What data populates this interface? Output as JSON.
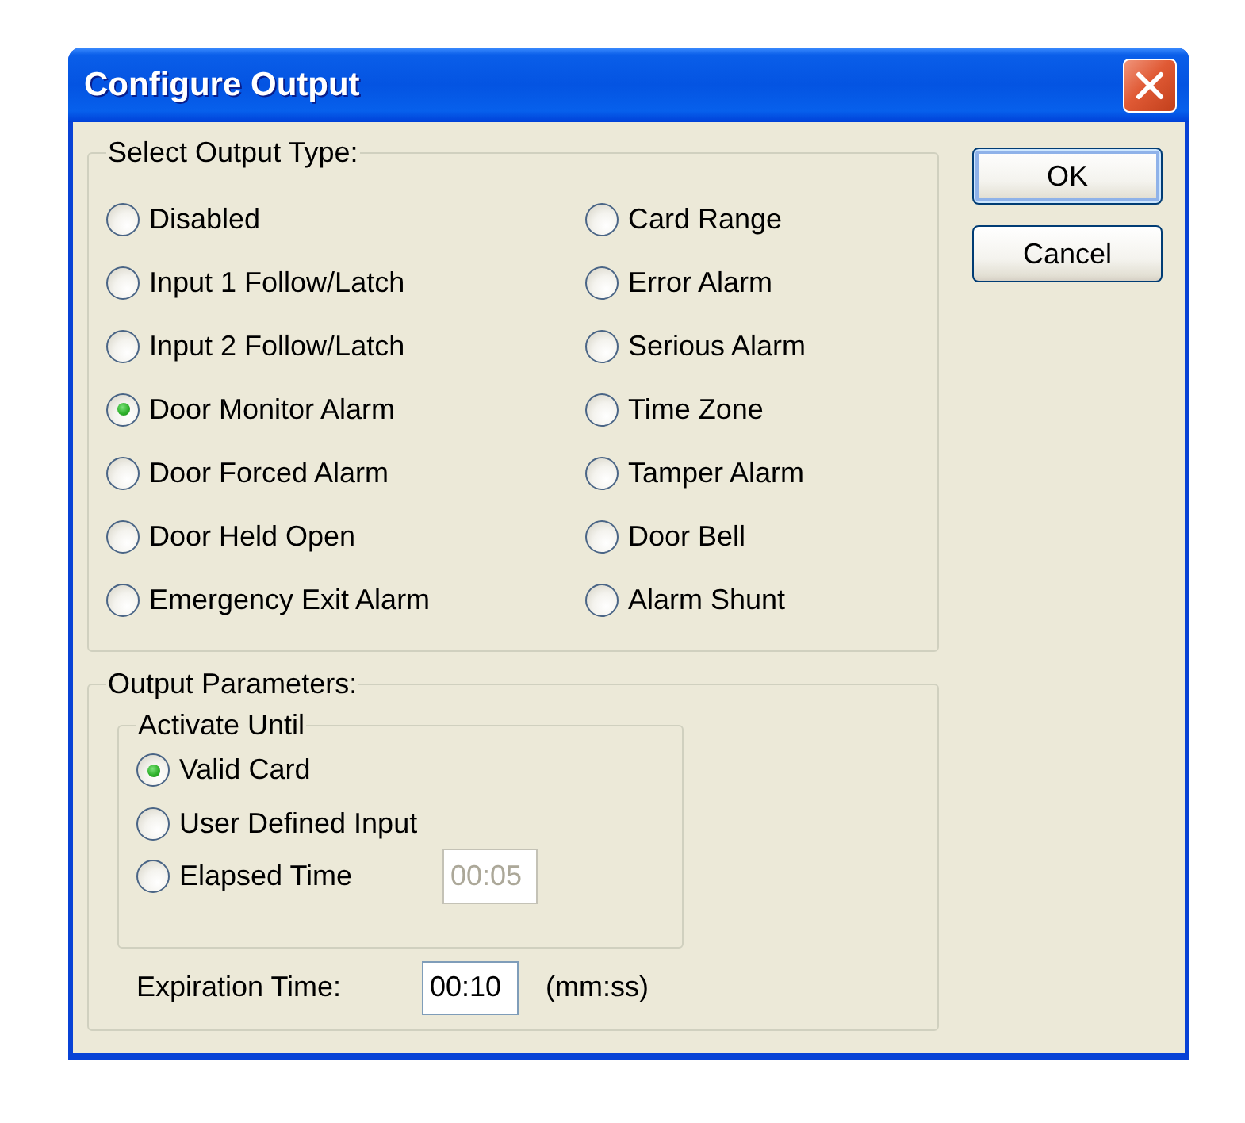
{
  "window": {
    "title": "Configure Output"
  },
  "output_type": {
    "label": "Select Output Type:",
    "options": [
      {
        "label": "Disabled",
        "selected": false
      },
      {
        "label": "Input 1 Follow/Latch",
        "selected": false
      },
      {
        "label": "Input 2 Follow/Latch",
        "selected": false
      },
      {
        "label": "Door Monitor Alarm",
        "selected": true
      },
      {
        "label": "Door Forced Alarm",
        "selected": false
      },
      {
        "label": "Door Held Open",
        "selected": false
      },
      {
        "label": "Emergency Exit Alarm",
        "selected": false
      },
      {
        "label": "Card Range",
        "selected": false
      },
      {
        "label": "Error Alarm",
        "selected": false
      },
      {
        "label": "Serious Alarm",
        "selected": false
      },
      {
        "label": "Time Zone",
        "selected": false
      },
      {
        "label": "Tamper Alarm",
        "selected": false
      },
      {
        "label": "Door Bell",
        "selected": false
      },
      {
        "label": "Alarm Shunt",
        "selected": false
      }
    ]
  },
  "output_parameters": {
    "label": "Output Parameters:",
    "activate_until": {
      "label": "Activate Until",
      "options": [
        {
          "label": "Valid Card",
          "selected": true
        },
        {
          "label": "User Defined Input",
          "selected": false
        },
        {
          "label": "Elapsed Time",
          "selected": false,
          "field": {
            "value": "00:05",
            "disabled": true
          }
        }
      ]
    },
    "expiration_time": {
      "label": "Expiration Time:",
      "value": "00:10",
      "unit": "(mm:ss)"
    }
  },
  "buttons": [
    {
      "label": "OK",
      "default": true
    },
    {
      "label": "Cancel",
      "default": false
    }
  ]
}
